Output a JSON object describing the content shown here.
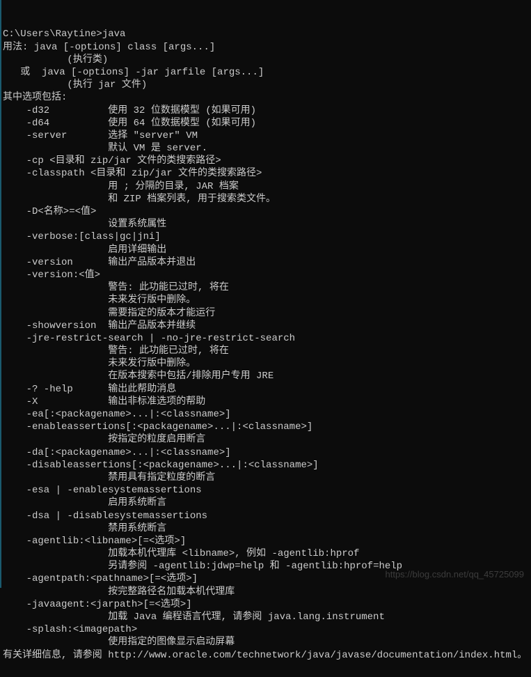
{
  "terminal": {
    "lines": [
      "C:\\Users\\Raytine>java",
      "用法: java [-options] class [args...]",
      "           (执行类)",
      "   或  java [-options] -jar jarfile [args...]",
      "           (执行 jar 文件)",
      "其中选项包括:",
      "    -d32          使用 32 位数据模型 (如果可用)",
      "    -d64          使用 64 位数据模型 (如果可用)",
      "    -server       选择 \"server\" VM",
      "                  默认 VM 是 server.",
      "",
      "    -cp <目录和 zip/jar 文件的类搜索路径>",
      "    -classpath <目录和 zip/jar 文件的类搜索路径>",
      "                  用 ; 分隔的目录, JAR 档案",
      "                  和 ZIP 档案列表, 用于搜索类文件。",
      "    -D<名称>=<值>",
      "                  设置系统属性",
      "    -verbose:[class|gc|jni]",
      "                  启用详细输出",
      "    -version      输出产品版本并退出",
      "    -version:<值>",
      "                  警告: 此功能已过时, 将在",
      "                  未来发行版中删除。",
      "                  需要指定的版本才能运行",
      "    -showversion  输出产品版本并继续",
      "    -jre-restrict-search | -no-jre-restrict-search",
      "                  警告: 此功能已过时, 将在",
      "                  未来发行版中删除。",
      "                  在版本搜索中包括/排除用户专用 JRE",
      "    -? -help      输出此帮助消息",
      "    -X            输出非标准选项的帮助",
      "    -ea[:<packagename>...|:<classname>]",
      "    -enableassertions[:<packagename>...|:<classname>]",
      "                  按指定的粒度启用断言",
      "    -da[:<packagename>...|:<classname>]",
      "    -disableassertions[:<packagename>...|:<classname>]",
      "                  禁用具有指定粒度的断言",
      "    -esa | -enablesystemassertions",
      "                  启用系统断言",
      "    -dsa | -disablesystemassertions",
      "                  禁用系统断言",
      "    -agentlib:<libname>[=<选项>]",
      "                  加载本机代理库 <libname>, 例如 -agentlib:hprof",
      "                  另请参阅 -agentlib:jdwp=help 和 -agentlib:hprof=help",
      "    -agentpath:<pathname>[=<选项>]",
      "                  按完整路径名加载本机代理库",
      "    -javaagent:<jarpath>[=<选项>]",
      "                  加载 Java 编程语言代理, 请参阅 java.lang.instrument",
      "    -splash:<imagepath>",
      "                  使用指定的图像显示启动屏幕",
      "有关详细信息, 请参阅 http://www.oracle.com/technetwork/java/javase/documentation/index.html。"
    ]
  },
  "watermark": "https://blog.csdn.net/qq_45725099"
}
